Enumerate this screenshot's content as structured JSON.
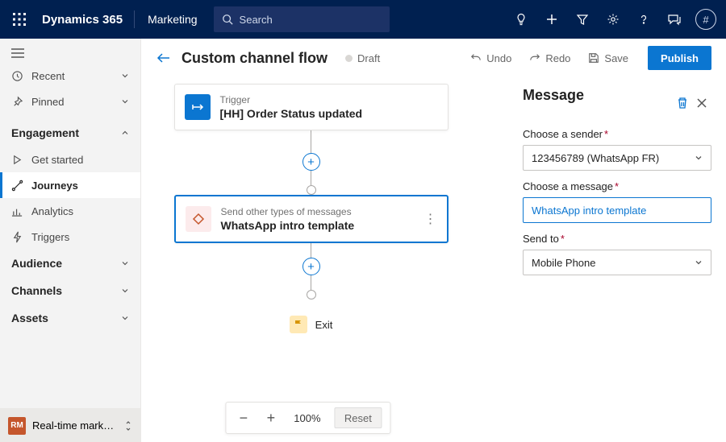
{
  "header": {
    "brand": "Dynamics 365",
    "module": "Marketing",
    "search_placeholder": "Search",
    "avatar_glyph": "#"
  },
  "sidebar": {
    "recent": "Recent",
    "pinned": "Pinned",
    "sections": {
      "engagement": {
        "label": "Engagement",
        "items": [
          "Get started",
          "Journeys",
          "Analytics",
          "Triggers"
        ],
        "selected_index": 1
      },
      "audience": {
        "label": "Audience"
      },
      "channels": {
        "label": "Channels"
      },
      "assets": {
        "label": "Assets"
      }
    },
    "area": {
      "badge": "RM",
      "name": "Real-time marketi..."
    }
  },
  "page": {
    "title": "Custom channel flow",
    "status": "Draft",
    "toolbar": {
      "undo": "Undo",
      "redo": "Redo",
      "save": "Save",
      "publish": "Publish"
    }
  },
  "flow": {
    "trigger": {
      "kind_label": "Trigger",
      "title": "[HH] Order Status updated"
    },
    "message": {
      "kind_label": "Send other types of messages",
      "title": "WhatsApp intro template"
    },
    "exit_label": "Exit"
  },
  "zoom": {
    "level": "100%",
    "reset": "Reset"
  },
  "panel": {
    "title": "Message",
    "sender": {
      "label": "Choose a sender",
      "value": "123456789 (WhatsApp FR)"
    },
    "message": {
      "label": "Choose a message",
      "value": "WhatsApp intro template"
    },
    "send_to": {
      "label": "Send to",
      "value": "Mobile Phone"
    }
  }
}
